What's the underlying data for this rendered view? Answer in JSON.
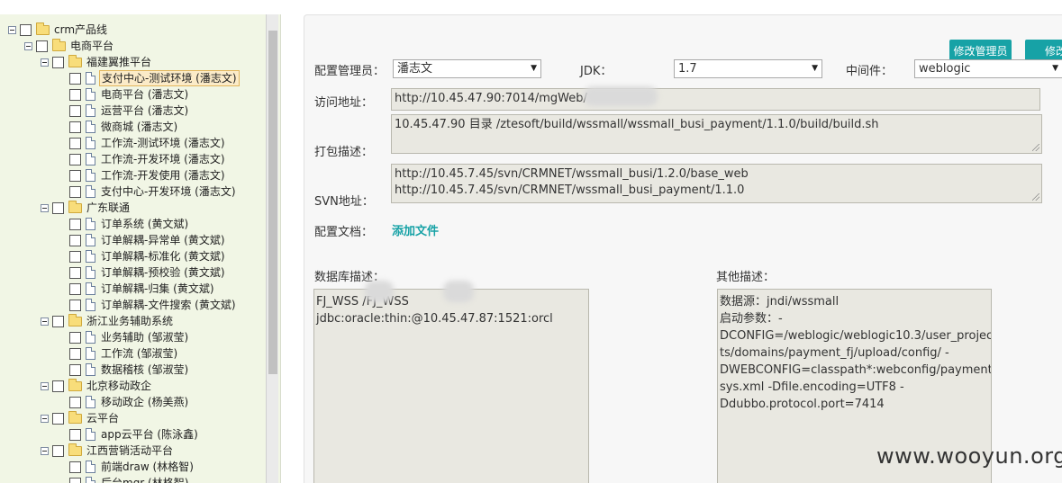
{
  "tree": {
    "root": {
      "label": "crm产品线"
    },
    "nodes": [
      {
        "label": "电商平台"
      },
      {
        "label": "福建翼推平台"
      },
      {
        "label": "支付中心-测试环境 (潘志文)"
      },
      {
        "label": "电商平台 (潘志文)"
      },
      {
        "label": "运营平台 (潘志文)"
      },
      {
        "label": "微商城 (潘志文)"
      },
      {
        "label": "工作流-测试环境 (潘志文)"
      },
      {
        "label": "工作流-开发环境 (潘志文)"
      },
      {
        "label": "工作流-开发使用 (潘志文)"
      },
      {
        "label": "支付中心-开发环境 (潘志文)"
      },
      {
        "label": "广东联通"
      },
      {
        "label": "订单系统 (黄文斌)"
      },
      {
        "label": "订单解耦-异常单 (黄文斌)"
      },
      {
        "label": "订单解耦-标准化 (黄文斌)"
      },
      {
        "label": "订单解耦-预校验 (黄文斌)"
      },
      {
        "label": "订单解耦-归集 (黄文斌)"
      },
      {
        "label": "订单解耦-文件搜索 (黄文斌)"
      },
      {
        "label": "浙江业务辅助系统"
      },
      {
        "label": "业务辅助 (邹淑莹)"
      },
      {
        "label": "工作流 (邹淑莹)"
      },
      {
        "label": "数据稽核 (邹淑莹)"
      },
      {
        "label": "北京移动政企"
      },
      {
        "label": "移动政企 (杨美燕)"
      },
      {
        "label": "云平台"
      },
      {
        "label": "app云平台 (陈泳鑫)"
      },
      {
        "label": "江西营销活动平台"
      },
      {
        "label": "前端draw (林格智)"
      },
      {
        "label": "后台mgr (林格智)"
      }
    ]
  },
  "form": {
    "buttons": {
      "modify_admin": "修改管理员",
      "modify": "修改"
    },
    "admin_label": "配置管理员：",
    "admin_value": "潘志文",
    "jdk_label": "JDK：",
    "jdk_value": "1.7",
    "middleware_label": "中间件：",
    "middleware_value": "weblogic",
    "access_label": "访问地址：",
    "access_value": "http://10.45.47.90:7014/mgWeb/",
    "build_label": "打包描述：",
    "build_value": "10.45.47.90  目录 /ztesoft/build/wssmall/wssmall_busi_payment/1.1.0/build/build.sh",
    "svn_label": "SVN地址：",
    "svn_lines": [
      "http://10.45.7.45/svn/CRMNET/wssmall_busi/1.2.0/base_web",
      "http://10.45.7.45/svn/CRMNET/wssmall_busi_payment/1.1.0"
    ],
    "doc_label": "配置文档：",
    "add_file_link": "添加文件",
    "db_label": "数据库描述：",
    "db_lines": [
      "FJ_WSS        /FJ_WSS",
      "jdbc:oracle:thin:@10.45.47.87:1521:orcl"
    ],
    "other_label": "其他描述：",
    "other_lines": [
      "数据源：jndi/wssmall",
      "启动参数：-",
      "DCONFIG=/weblogic/weblogic10.3/user_projec",
      "ts/domains/payment_fj/upload/config/ -",
      "DWEBCONFIG=classpath*:webconfig/payment_",
      "sys.xml -Dfile.encoding=UTF8 -",
      "Ddubbo.protocol.port=7414"
    ]
  },
  "watermark": "www.wooyun.org"
}
